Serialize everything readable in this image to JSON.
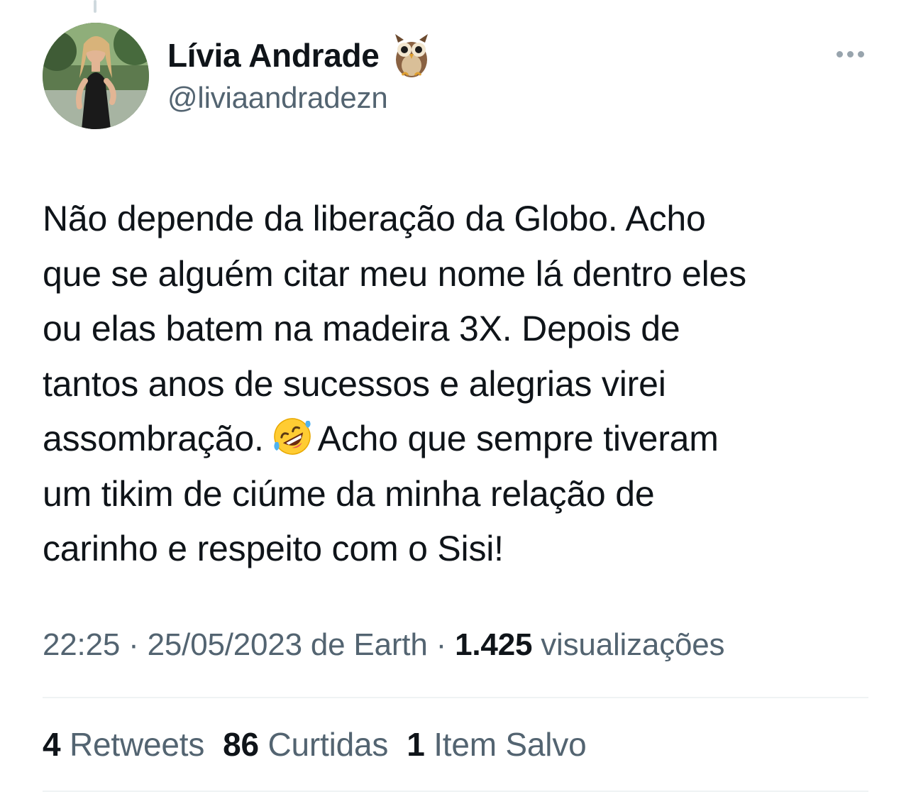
{
  "author": {
    "display_name": "Lívia Andrade",
    "handle": "@liviaandradezn",
    "name_emoji": "owl-icon",
    "avatar": "profile-photo"
  },
  "more_button": {
    "icon": "more-horizontal-icon"
  },
  "tweet": {
    "lines": [
      "Não depende da liberação da Globo. Acho",
      "que se alguém citar meu nome lá dentro eles",
      "ou elas batem na madeira 3X. Depois de",
      "tantos anos de sucessos e alegrias virei"
    ],
    "line5_before": "assombração.",
    "line5_emoji": "rofl-emoji",
    "line5_after": "Acho que sempre tiveram",
    "lines_end": [
      "um tikim de ciúme da minha relação de",
      "carinho e respeito com o Sisi!"
    ]
  },
  "meta": {
    "time": "22:25",
    "sep1": " · ",
    "date": "25/05/2023",
    "source": " de Earth",
    "sep2": " · ",
    "views_count": "1.425",
    "views_label": " visualizações"
  },
  "stats": {
    "retweets_count": "4",
    "retweets_label": "Retweets",
    "likes_count": "86",
    "likes_label": "Curtidas",
    "bookmarks_count": "1",
    "bookmarks_label": "Item Salvo"
  },
  "colors": {
    "text_primary": "#0f1419",
    "text_secondary": "#536471",
    "divider": "#eff3f4"
  }
}
